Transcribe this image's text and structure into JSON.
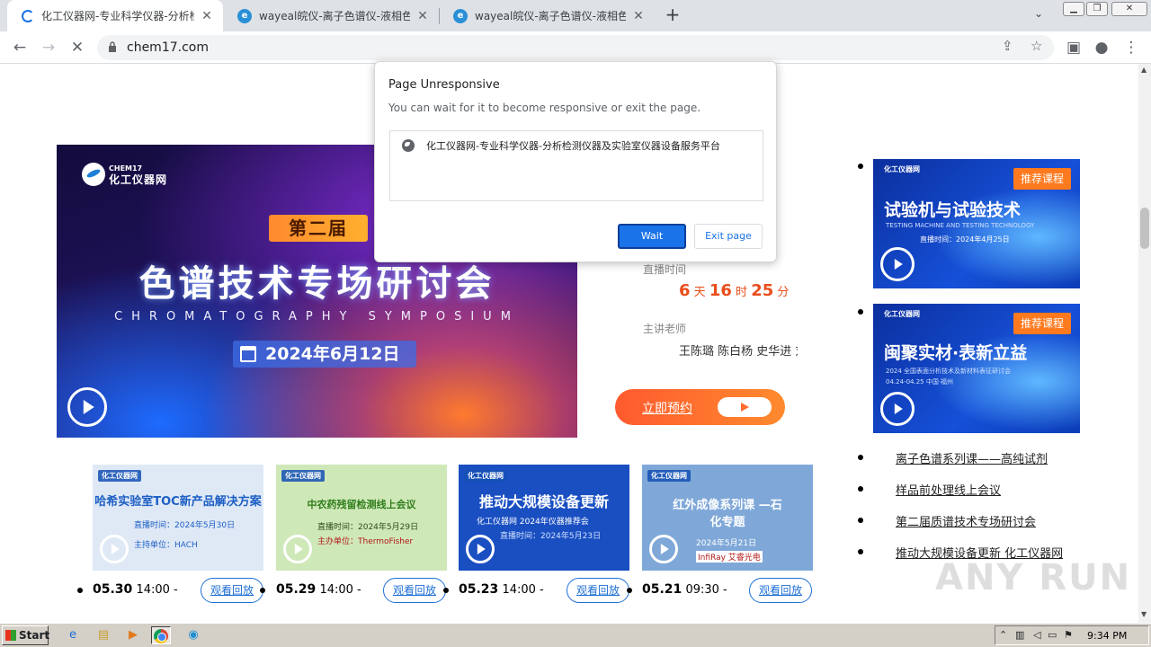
{
  "browser": {
    "tabs": [
      {
        "title": "化工仪器网-专业科学仪器-分析检测",
        "state": "loading"
      },
      {
        "title": "wayeal皖仪-离子色谱仪-液相色谱仪",
        "state": "loaded"
      },
      {
        "title": "wayeal皖仪-离子色谱仪-液相色谱仪",
        "state": "loaded"
      }
    ],
    "new_tab": "+",
    "url": "chem17.com"
  },
  "page": {
    "main_banner": {
      "logo_en": "CHEM17",
      "logo_cn": "化工仪器网",
      "edition": "第二届",
      "title": "色谱技术专场研讨会",
      "subtitle": "CHROMATOGRAPHY SYMPOSIUM",
      "date": "2024年6月12日"
    },
    "info": {
      "live_time_label": "直播时间",
      "countdown": {
        "days": "6",
        "day_unit": "天",
        "hours": "16",
        "hour_unit": "时",
        "minutes": "25",
        "minute_unit": "分"
      },
      "teacher_label": "主讲老师",
      "teachers": "王陈璐 陈白杨 史华进 刘",
      "reserve_button": "立即预约"
    },
    "thumbnails": [
      {
        "title": "哈希实验室TOC新产品解决方案",
        "meta1": "直播时间：2024年5月30日",
        "meta2": "主持单位：HACH",
        "date": "05.30",
        "time": "14:00 -",
        "replay": "观看回放",
        "bg": "#dfe9f6",
        "title_color": "#1d5fc4"
      },
      {
        "title": "中农药残留检测线上会议",
        "meta1": "直播时间：2024年5月29日",
        "meta2": "主办单位：ThermoFisher",
        "date": "05.29",
        "time": "14:00 -",
        "replay": "观看回放",
        "bg": "#cfe8b8",
        "title_color": "#2e7d1a"
      },
      {
        "title": "推动大规模设备更新",
        "meta1": "化工仪器网 2024年仪器推荐会",
        "meta2": "直播时间：2024年5月23日",
        "date": "05.23",
        "time": "14:00 -",
        "replay": "观看回放",
        "bg": "#1a4fc2",
        "title_color": "#ffffff"
      },
      {
        "title": "红外成像系列课 —石化专题",
        "meta1": "2024年5月21日",
        "meta2": "InfiRay 艾睿光电",
        "date": "05.21",
        "time": "09:30 -",
        "replay": "观看回放",
        "bg": "#7fa8d8",
        "title_color": "#ffffff"
      }
    ],
    "side_banners": [
      {
        "badge": "推荐课程",
        "title": "试验机与试验技术",
        "sub": "TESTING MACHINE AND TESTING TECHNOLOGY",
        "meta": "直播时间：2024年4月25日"
      },
      {
        "badge": "推荐课程",
        "title": "闽聚实材·表新立益",
        "sub": "2024 全国表面分析技术及新材料表征研讨会",
        "meta": "04.24-04.25 中国·福州"
      }
    ],
    "side_links": [
      "离子色谱系列课——高纯试剂",
      "样品前处理线上会议",
      "第二届质谱技术专场研讨会",
      "推动大规模设备更新 化工仪器网"
    ]
  },
  "dialog": {
    "title": "Page Unresponsive",
    "message": "You can wait for it to become responsive or exit the page.",
    "page_title": "化工仪器网-专业科学仪器-分析检测仪器及实验室仪器设备服务平台",
    "wait_button": "Wait",
    "exit_button": "Exit page"
  },
  "watermark": "ANY RUN",
  "taskbar": {
    "start": "Start",
    "clock": "9:34 PM"
  }
}
